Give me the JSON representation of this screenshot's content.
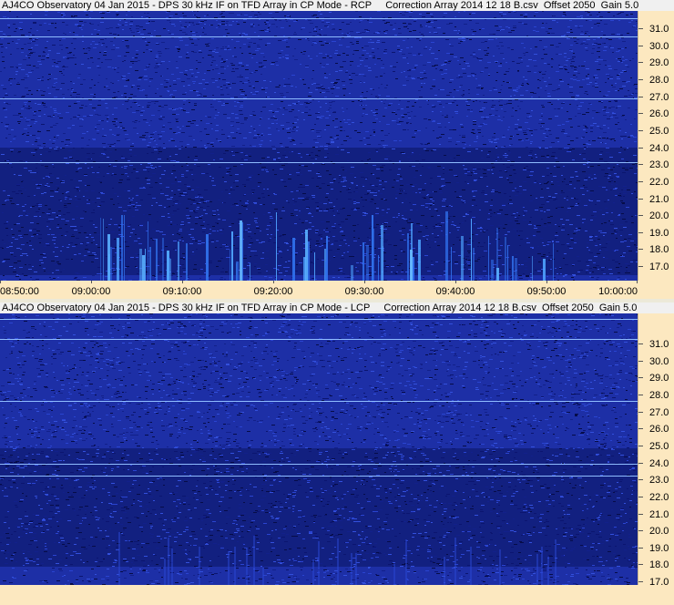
{
  "top_panel": {
    "title": "AJ4CO Observatory 04 Jan 2015 - DPS 30 kHz IF on TFD Array in CP Mode - RCP     Correction Array 2014 12 18 B.csv  Offset 2050  Gain 5.0",
    "freq_labels": [
      "31.0",
      "30.0",
      "29.0",
      "28.0",
      "27.0",
      "26.0",
      "25.0",
      "24.0",
      "23.0",
      "22.0",
      "21.0",
      "20.0",
      "19.0",
      "18.0",
      "17.0"
    ],
    "time_labels": [
      "08:50:00",
      "09:00:00",
      "09:10:00",
      "09:20:00",
      "09:30:00",
      "09:40:00",
      "09:50:00",
      "10:00:00"
    ]
  },
  "bottom_panel": {
    "title": "AJ4CO Observatory 04 Jan 2015 - DPS 30 kHz IF on TFD Array in CP Mode - LCP     Correction Array 2014 12 18 B.csv  Offset 2050  Gain 5.0",
    "freq_labels": [
      "31.0",
      "30.0",
      "29.0",
      "28.0",
      "27.0",
      "26.0",
      "25.0",
      "24.0",
      "23.0",
      "22.0",
      "21.0",
      "20.0",
      "19.0",
      "18.0",
      "17.0"
    ]
  },
  "colors": {
    "background_blue": "#1a2fa8",
    "dark_blue": "#0a1250",
    "bright_line": "#7fb4ff",
    "axis_bg": "#fce8c0"
  }
}
